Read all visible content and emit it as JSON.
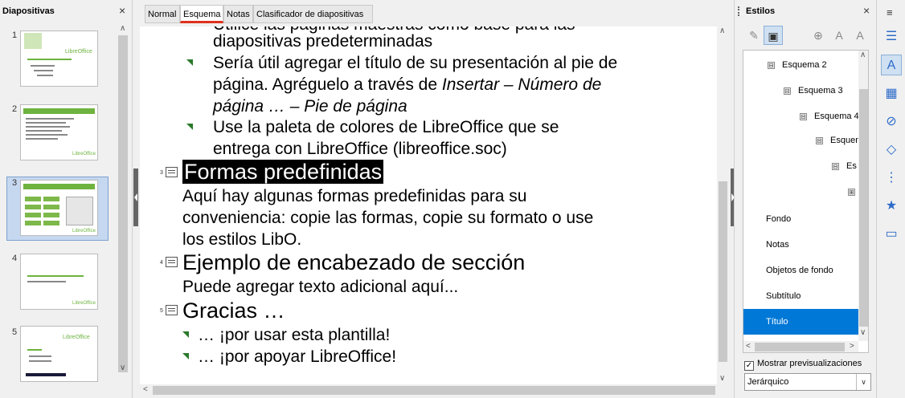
{
  "slides_pane": {
    "title": "Diapositivas",
    "close": "×",
    "slides": [
      {
        "number": "1",
        "logo": "LibreOffice"
      },
      {
        "number": "2",
        "logo": "LibreOffice"
      },
      {
        "number": "3",
        "logo": "LibreOffice"
      },
      {
        "number": "4",
        "logo": "LibreOffice"
      },
      {
        "number": "5",
        "logo": "LibreOffice"
      }
    ]
  },
  "tabs": [
    "Normal",
    "Esquema",
    "Notas",
    "Clasificador de diapositivas"
  ],
  "outline": {
    "partial_top_1": "Utilice las páginas maestras como base para las",
    "partial_top_2": "diapositivas predeterminadas",
    "b1_line1": "Sería útil agregar el título de su presentación al pie de",
    "b1_line2_plain": "página. Agréguelo a través de ",
    "b1_line2_italic": "Insertar – Número de",
    "b1_line3_italic": "página … – Pie de página",
    "b2_line1": "Use la paleta de colores de LibreOffice que se",
    "b2_line2": "entrega con LibreOffice (libreoffice.soc)",
    "s3_num": "3",
    "s3_title": "Formas predefinidas",
    "s3_line1": "Aquí hay algunas formas predefinidas para su",
    "s3_line2": "conveniencia: copie las formas, copie su formato o use",
    "s3_line3": "los estilos LibO.",
    "s4_num": "4",
    "s4_title": "Ejemplo de encabezado de sección",
    "s4_line1": "Puede agregar texto adicional aquí...",
    "s5_num": "5",
    "s5_title": "Gracias …",
    "s5_b1": "… ¡por usar esta plantilla!",
    "s5_b2": "… ¡por apoyar LibreOffice!"
  },
  "styles_pane": {
    "title": "Estilos",
    "close": "×",
    "tree": [
      {
        "label": "Esquema 2",
        "exp": "⊟"
      },
      {
        "label": "Esquema 3",
        "exp": "⊟"
      },
      {
        "label": "Esquema 4",
        "exp": "⊟"
      },
      {
        "label": "Esquem",
        "exp": "⊟"
      },
      {
        "label": "Es",
        "exp": "⊟"
      },
      {
        "label": "",
        "exp": "⊞"
      },
      {
        "label": "Fondo"
      },
      {
        "label": "Notas"
      },
      {
        "label": "Objetos de fondo"
      },
      {
        "label": "Subtítulo"
      },
      {
        "label": "Título"
      }
    ],
    "show_previews_label": "Mostrar previsualizaciones",
    "show_previews_checked": "✓",
    "filter_value": "Jerárquico"
  },
  "deck": {
    "menu_icon": "hamburger-icon"
  },
  "colors": {
    "accent": "#0078d7",
    "active_tab_underline": "#e0311e",
    "bullet_green": "#2a7a2a",
    "libreoffice_green": "#6eb33f"
  }
}
